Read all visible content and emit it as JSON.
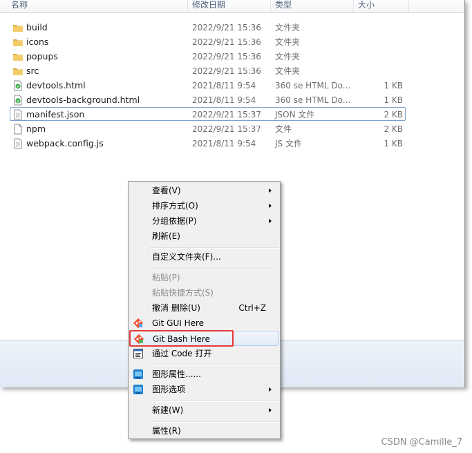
{
  "columns": {
    "name": "名称",
    "date": "修改日期",
    "type": "类型",
    "size": "大小"
  },
  "files": [
    {
      "name": "build",
      "date": "2022/9/21 15:36",
      "type": "文件夹",
      "size": "",
      "icon": "folder-icon"
    },
    {
      "name": "icons",
      "date": "2022/9/21 15:36",
      "type": "文件夹",
      "size": "",
      "icon": "folder-icon"
    },
    {
      "name": "popups",
      "date": "2022/9/21 15:36",
      "type": "文件夹",
      "size": "",
      "icon": "folder-icon"
    },
    {
      "name": "src",
      "date": "2022/9/21 15:36",
      "type": "文件夹",
      "size": "",
      "icon": "folder-icon"
    },
    {
      "name": "devtools.html",
      "date": "2021/8/11 9:54",
      "type": "360 se HTML Do...",
      "size": "1 KB",
      "icon": "html-file-icon"
    },
    {
      "name": "devtools-background.html",
      "date": "2021/8/11 9:54",
      "type": "360 se HTML Do...",
      "size": "1 KB",
      "icon": "html-file-icon"
    },
    {
      "name": "manifest.json",
      "date": "2022/9/21 15:37",
      "type": "JSON 文件",
      "size": "2 KB",
      "icon": "text-file-icon",
      "selected": true
    },
    {
      "name": "npm",
      "date": "2022/9/21 15:37",
      "type": "文件",
      "size": "2 KB",
      "icon": "blank-file-icon"
    },
    {
      "name": "webpack.config.js",
      "date": "2021/8/11 9:54",
      "type": "JS 文件",
      "size": "1 KB",
      "icon": "text-file-icon"
    }
  ],
  "menu": {
    "view": "查看(V)",
    "sort": "排序方式(O)",
    "group": "分组依据(P)",
    "refresh": "刷新(E)",
    "customize": "自定义文件夹(F)...",
    "paste": "粘贴(P)",
    "paste_shortcut": "粘贴快捷方式(S)",
    "undo": "撤消 删除(U)",
    "undo_shortcut": "Ctrl+Z",
    "git_gui": "Git GUI Here",
    "git_bash": "Git Bash Here",
    "vscode": "通过 Code 打开",
    "graphics_props": "图形属性......",
    "graphics_opts": "图形选项",
    "new": "新建(W)",
    "properties": "属性(R)"
  },
  "watermark": "CSDN @Camille_7",
  "colors": {
    "highlight_border": "#e53935",
    "selection_border": "#7da2ce",
    "folder": "#e8c15a"
  }
}
